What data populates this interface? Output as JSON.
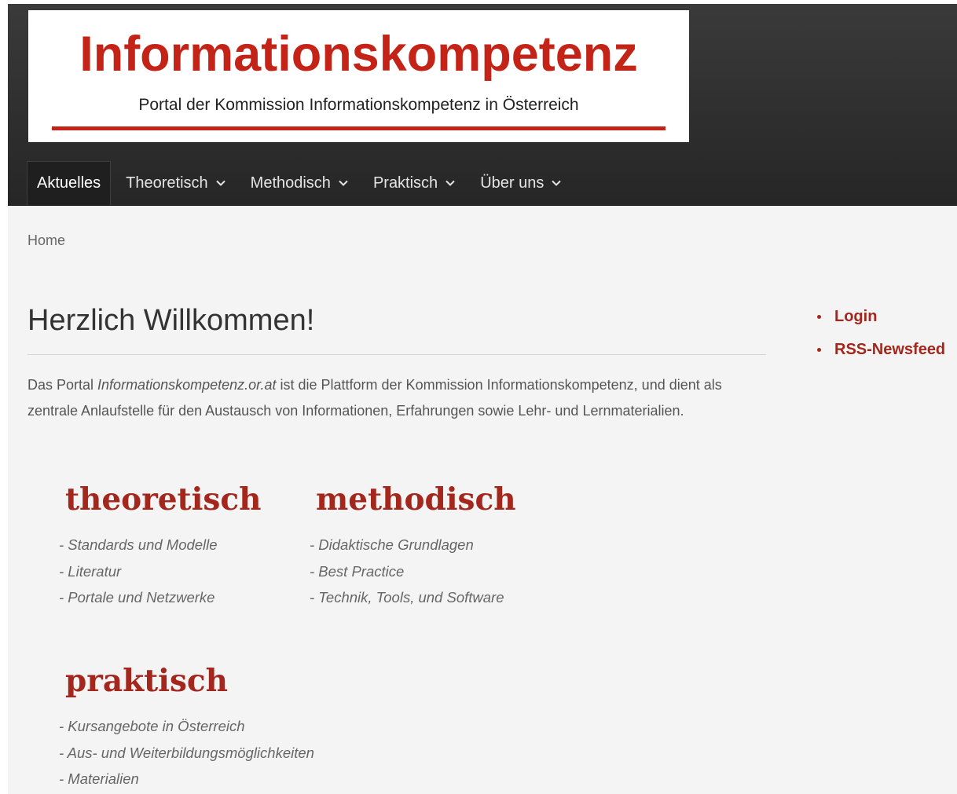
{
  "header": {
    "logo_title": "Informationskompetenz",
    "logo_subtitle": "Portal der Kommission Informationskompetenz in Österreich"
  },
  "nav": {
    "items": [
      {
        "label": "Aktuelles",
        "active": true,
        "has_dropdown": false
      },
      {
        "label": "Theoretisch",
        "active": false,
        "has_dropdown": true
      },
      {
        "label": "Methodisch",
        "active": false,
        "has_dropdown": true
      },
      {
        "label": "Praktisch",
        "active": false,
        "has_dropdown": true
      },
      {
        "label": "Über uns",
        "active": false,
        "has_dropdown": true
      }
    ]
  },
  "breadcrumb": {
    "home": "Home"
  },
  "main": {
    "title": "Herzlich Willkommen!",
    "intro_before": "Das Portal ",
    "intro_italic": "Informationskompetenz.or.at",
    "intro_after": " ist die Plattform der Kommission Informationskompetenz, und dient als zentrale Anlaufstelle für den Austausch von Informationen, Erfahrungen sowie Lehr- und Lernmaterialien."
  },
  "categories": {
    "theoretisch": {
      "title": "theoretisch",
      "links": [
        "- Standards und Modelle",
        "- Literatur",
        "- Portale und Netzwerke"
      ]
    },
    "methodisch": {
      "title": "methodisch",
      "links": [
        "- Didaktische Grundlagen",
        "- Best Practice",
        "- Technik, Tools, und Software"
      ]
    },
    "praktisch": {
      "title": "praktisch",
      "links": [
        "- Kursangebote in Österreich",
        "- Aus- und Weiterbildungsmöglichkeiten",
        "- Materialien"
      ]
    }
  },
  "sidebar": {
    "login": "Login",
    "rss": "RSS-Newsfeed"
  },
  "colors": {
    "brand_red": "#c42418",
    "accent_red": "#a3271c",
    "header_bg": "#2e2e2e",
    "page_bg": "#f4f4f4"
  },
  "icons": {
    "dropdown": "chevron-down-icon",
    "bullet": "bullet-dot-icon"
  }
}
